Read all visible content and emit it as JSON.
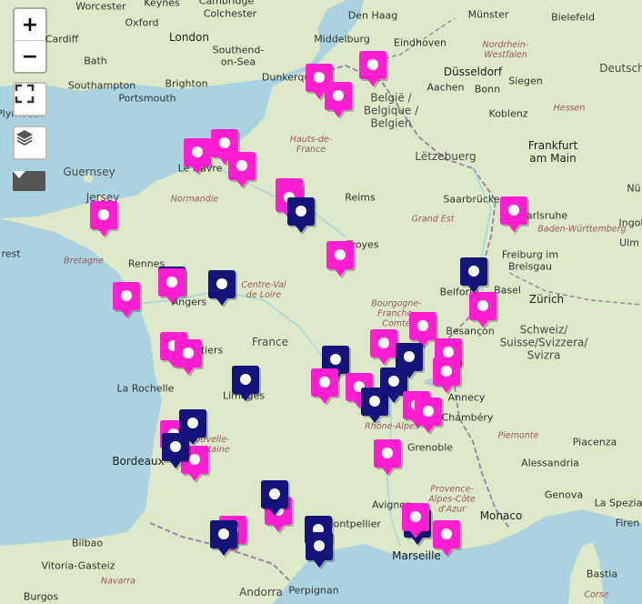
{
  "controls": {
    "zoom_in": "+",
    "zoom_out": "−",
    "fullscreen_icon": "fullscreen-icon",
    "layers_icon": "layers-icon",
    "dropdown_icon": "caret-down-icon"
  },
  "colors": {
    "land": "#dde8c8",
    "sea": "#aad3df",
    "border": "#9e86a8",
    "marker_magenta": "#ff1fd0",
    "marker_navy": "#14147a"
  },
  "labels": {
    "worcester": "Worcester",
    "keynes": "Keynes",
    "cambridge": "Cambridge",
    "colchester": "Colchester",
    "oxford": "Oxford",
    "den_haag": "Den Haag",
    "munster": "Münster",
    "bielefeld": "Bielefeld",
    "cardiff": "Cardiff",
    "london": "London",
    "southend": "Southend-on-Sea",
    "middelburg": "Middelburg",
    "eindhoven": "Eindhoven",
    "nordrhein": "Nordrhein-Westfalen",
    "bath": "Bath",
    "dunkerque": "Dunkerque",
    "dusseldorf": "Düsseldorf",
    "southampton": "Southampton",
    "brighton": "Brighton",
    "portsmouth": "Portsmouth",
    "aachen": "Aachen",
    "siegen": "Siegen",
    "deutschland": "Deutsch",
    "belgie": "België / Belgique / Belgien",
    "bonn": "Bonn",
    "hessen": "Hessen",
    "plymouth": "Plymouth",
    "koblenz": "Koblenz",
    "hauts": "Hauts-de-France",
    "guernsey": "Guernsey",
    "le_havre": "Le Havre",
    "letzebuerg": "Lëtzebuerg",
    "frankfurt": "Frankfurt am Main",
    "jersey": "Jersey",
    "normandie": "Normandie",
    "reims": "Reims",
    "saarbrucken": "Saarbrücken",
    "nurnberg": "Nü",
    "grand_est": "Grand Est",
    "karlsruhe": "Karlsruhe",
    "ingolstadt": "Ingol",
    "baden": "Baden-Württemberg",
    "ulm": "Ulm",
    "brest": "rest",
    "troyes": "Troyes",
    "bretagne": "Bretagne",
    "rennes": "Rennes",
    "freiburg": "Freiburg im Breisgau",
    "centre": "Centre-Val de Loire",
    "belfort": "Belfort",
    "basel": "Basel",
    "angers": "Angers",
    "bourgogne": "Bourgogne-Franche-Comté",
    "zurich": "Zürich",
    "besancon": "Besançon",
    "schweiz": "Schweiz/ Suisse/Svizzera/ Svizra",
    "france": "France",
    "poitiers": "Poitiers",
    "la_rochelle": "La Rochelle",
    "limoges": "Limoges",
    "annecy": "Annecy",
    "chambery": "Chambéry",
    "rhone": "Rhône-Alpes",
    "nouvelle": "Nouvelle-Aquitaine",
    "piemonte": "Piemonte",
    "bordeaux": "Bordeaux",
    "grenoble": "Grenoble",
    "piacenza": "Piacenza",
    "alessandria": "Alessandria",
    "genova": "Genova",
    "provence": "Provence-Alpes-Côte d'Azur",
    "la_spezia": "La Spezia",
    "avignon": "Avignon",
    "monaco": "Monaco",
    "montpellier": "Montpellier",
    "bilbao": "Bilbao",
    "firenze": "Firen",
    "marseille": "Marseille",
    "vitoria": "Vitoria-Gasteiz",
    "navarra": "Navarra",
    "bastia": "Bastia",
    "burgos": "Burgos",
    "andorra": "Andorra",
    "perpignan": "Perpignan",
    "corse": "Corse"
  },
  "markers": [
    {
      "color": "magenta"
    },
    {
      "color": "magenta"
    },
    {
      "color": "magenta"
    },
    {
      "color": "magenta"
    },
    {
      "color": "magenta"
    },
    {
      "color": "magenta"
    },
    {
      "color": "magenta"
    },
    {
      "color": "magenta"
    },
    {
      "color": "navy"
    },
    {
      "color": "magenta"
    },
    {
      "color": "magenta"
    },
    {
      "color": "magenta"
    },
    {
      "color": "navy"
    },
    {
      "color": "magenta"
    },
    {
      "color": "magenta"
    },
    {
      "color": "navy"
    },
    {
      "color": "magenta"
    },
    {
      "color": "magenta"
    },
    {
      "color": "magenta"
    },
    {
      "color": "magenta"
    },
    {
      "color": "magenta"
    },
    {
      "color": "navy"
    },
    {
      "color": "navy"
    },
    {
      "color": "magenta"
    },
    {
      "color": "navy"
    },
    {
      "color": "magenta"
    },
    {
      "color": "magenta"
    },
    {
      "color": "magenta"
    },
    {
      "color": "navy"
    },
    {
      "color": "navy"
    },
    {
      "color": "magenta"
    },
    {
      "color": "magenta"
    },
    {
      "color": "magenta"
    },
    {
      "color": "magenta"
    },
    {
      "color": "navy"
    },
    {
      "color": "navy"
    },
    {
      "color": "magenta"
    },
    {
      "color": "navy"
    },
    {
      "color": "magenta"
    },
    {
      "color": "navy"
    },
    {
      "color": "magenta"
    },
    {
      "color": "navy"
    },
    {
      "color": "navy"
    },
    {
      "color": "magenta"
    },
    {
      "color": "navy"
    },
    {
      "color": "magenta"
    },
    {
      "color": "navy"
    }
  ]
}
